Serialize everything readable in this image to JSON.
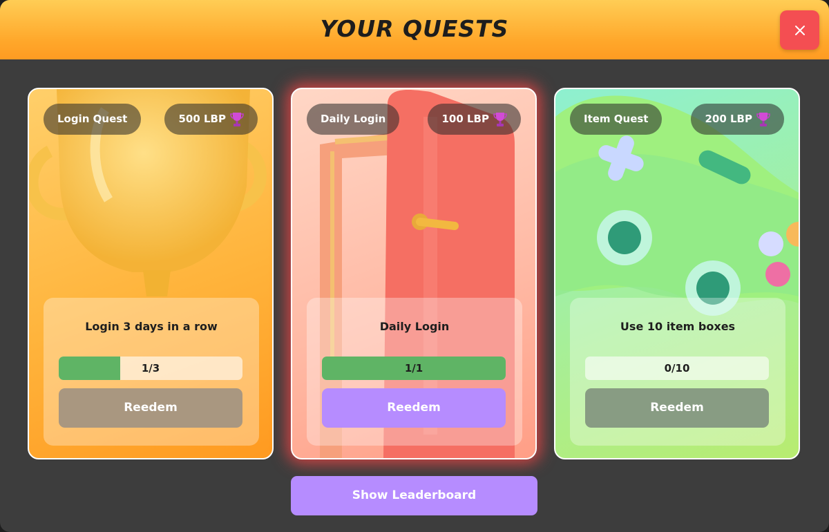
{
  "header": {
    "title": "YOUR QUESTS",
    "close_icon": "close-icon"
  },
  "quests": [
    {
      "category": "Login Quest",
      "reward": "500 LBP",
      "reward_icon": "trophy-icon",
      "description": "Login 3 days in a row",
      "progress_text": "1/3",
      "progress": 0.333,
      "action_label": "Reedem",
      "action_enabled": false,
      "artwork_icon": "trophy-cup-icon"
    },
    {
      "category": "Daily Login",
      "reward": "100 LBP",
      "reward_icon": "trophy-icon",
      "description": "Daily Login",
      "progress_text": "1/1",
      "progress": 1.0,
      "action_label": "Reedem",
      "action_enabled": true,
      "artwork_icon": "door-icon"
    },
    {
      "category": "Item Quest",
      "reward": "200 LBP",
      "reward_icon": "trophy-icon",
      "description": "Use 10 item boxes",
      "progress_text": "0/10",
      "progress": 0.0,
      "action_label": "Reedem",
      "action_enabled": false,
      "artwork_icon": "gamepad-icon"
    }
  ],
  "footer": {
    "leaderboard_label": "Show Leaderboard"
  },
  "colors": {
    "header_top": "#ffcd55",
    "header_bottom": "#ff9b22",
    "close_button": "#f44e52",
    "progress_fill": "#5fb465",
    "action_active": "#b68cff",
    "highlight_glow": "#ff4646"
  }
}
